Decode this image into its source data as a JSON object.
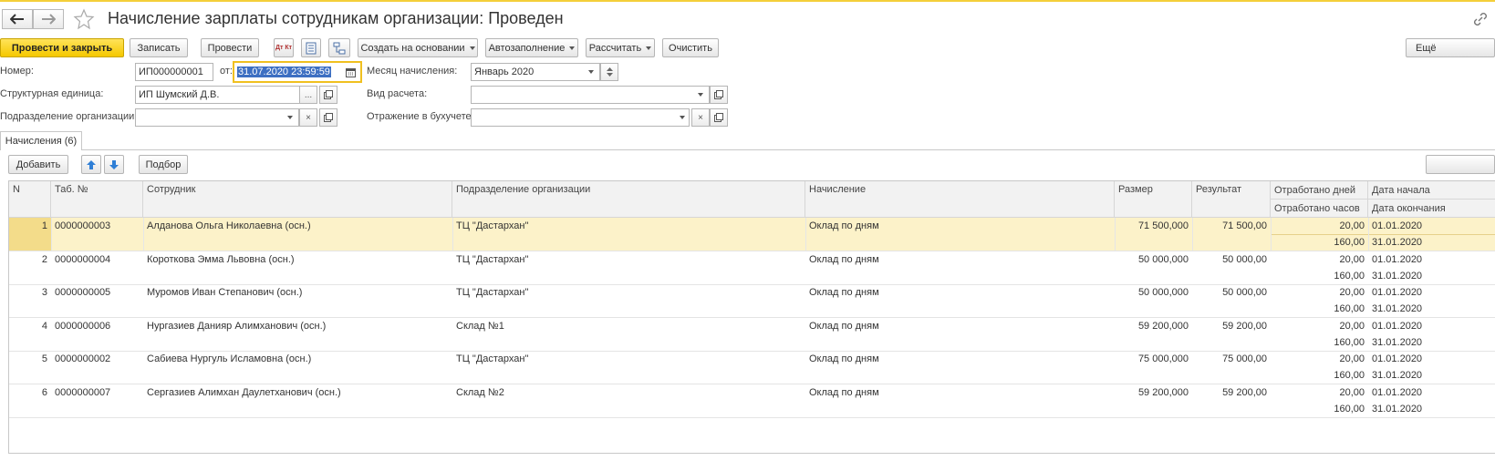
{
  "window": {
    "title": "Начисление зарплаты сотрудникам организации: Проведен"
  },
  "toolbar": {
    "post_and_close": "Провести и закрыть",
    "save": "Записать",
    "post": "Провести",
    "dtkt_label": "Дт Кт",
    "create_based_on": "Создать на основании",
    "autofill": "Автозаполнение",
    "calculate": "Рассчитать",
    "clear": "Очистить",
    "more": "Ещё"
  },
  "form": {
    "number_label": "Номер:",
    "number_value": "ИП000000001",
    "date_label": "от:",
    "date_value": "31.07.2020 23:59:59",
    "month_label": "Месяц начисления:",
    "month_value": "Январь 2020",
    "struct_unit_label": "Структурная единица:",
    "struct_unit_value": "ИП Шумский Д.В.",
    "calc_type_label": "Вид расчета:",
    "calc_type_value": "",
    "subdivision_label": "Подразделение организации:",
    "subdivision_value": "",
    "accounting_label": "Отражение в бухучете:",
    "accounting_value": "",
    "ellipsis": "...",
    "clear_x": "×"
  },
  "tabs": [
    {
      "label": "Начисления (6)"
    }
  ],
  "table_toolbar": {
    "add": "Добавить",
    "pick": "Подбор"
  },
  "table": {
    "columns": {
      "n": "N",
      "tab_no": "Таб. №",
      "employee": "Сотрудник",
      "subdivision": "Подразделение организации",
      "accrual": "Начисление",
      "size": "Размер",
      "result": "Результат",
      "days_worked": "Отработано дней",
      "hours_worked": "Отработано часов",
      "start_date": "Дата начала",
      "end_date": "Дата окончания"
    },
    "rows": [
      {
        "n": "1",
        "tab_no": "0000000003",
        "employee": "Алданова Ольга Николаевна (осн.)",
        "subdivision": "ТЦ \"Дастархан\"",
        "accrual": "Оклад по дням",
        "size": "71 500,000",
        "result": "71 500,00",
        "days": "20,00",
        "hours": "160,00",
        "start": "01.01.2020",
        "end": "31.01.2020"
      },
      {
        "n": "2",
        "tab_no": "0000000004",
        "employee": "Короткова Эмма Львовна (осн.)",
        "subdivision": "ТЦ \"Дастархан\"",
        "accrual": "Оклад по дням",
        "size": "50 000,000",
        "result": "50 000,00",
        "days": "20,00",
        "hours": "160,00",
        "start": "01.01.2020",
        "end": "31.01.2020"
      },
      {
        "n": "3",
        "tab_no": "0000000005",
        "employee": "Муромов Иван Степанович (осн.)",
        "subdivision": "ТЦ \"Дастархан\"",
        "accrual": "Оклад по дням",
        "size": "50 000,000",
        "result": "50 000,00",
        "days": "20,00",
        "hours": "160,00",
        "start": "01.01.2020",
        "end": "31.01.2020"
      },
      {
        "n": "4",
        "tab_no": "0000000006",
        "employee": "Нургазиев Данияр Алимханович (осн.)",
        "subdivision": "Склад №1",
        "accrual": "Оклад по дням",
        "size": "59 200,000",
        "result": "59 200,00",
        "days": "20,00",
        "hours": "160,00",
        "start": "01.01.2020",
        "end": "31.01.2020"
      },
      {
        "n": "5",
        "tab_no": "0000000002",
        "employee": "Сабиева Нургуль Исламовна (осн.)",
        "subdivision": "ТЦ \"Дастархан\"",
        "accrual": "Оклад по дням",
        "size": "75 000,000",
        "result": "75 000,00",
        "days": "20,00",
        "hours": "160,00",
        "start": "01.01.2020",
        "end": "31.01.2020"
      },
      {
        "n": "6",
        "tab_no": "0000000007",
        "employee": "Сергазиев Алимхан Даулетханович (осн.)",
        "subdivision": "Склад №2",
        "accrual": "Оклад по дням",
        "size": "59 200,000",
        "result": "59 200,00",
        "days": "20,00",
        "hours": "160,00",
        "start": "01.01.2020",
        "end": "31.01.2020"
      }
    ]
  },
  "colors": {
    "accent": "#f5c800",
    "selected_row": "#fcf2c9",
    "date_focus": "#f0c020"
  }
}
